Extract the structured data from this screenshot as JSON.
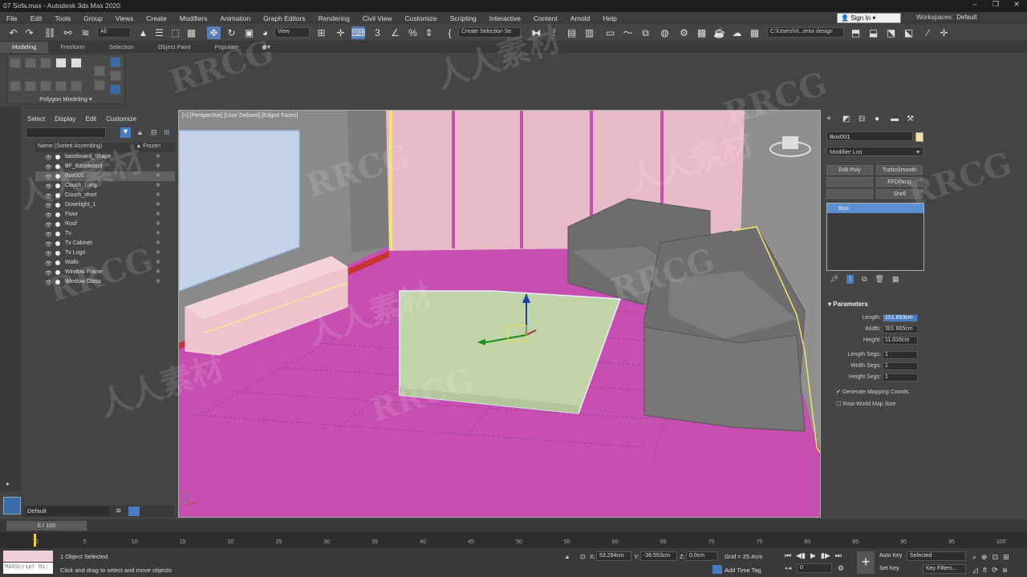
{
  "title": "07 Sofa.max - Autodesk 3ds Max 2020",
  "menu": [
    "File",
    "Edit",
    "Tools",
    "Group",
    "Views",
    "Create",
    "Modifiers",
    "Animation",
    "Graph Editors",
    "Rendering",
    "Civil View",
    "Customize",
    "Scripting",
    "Interactive",
    "Content",
    "Arnold",
    "Help"
  ],
  "signin": "Sign In",
  "workspace_label": "Workspaces:",
  "workspace_value": "Default",
  "toolbar": {
    "filter": "All",
    "refcoord": "View",
    "selset": "Create Selection Se",
    "path": "C:\\Users\\Vi...erior design"
  },
  "ribbon": {
    "tabs": [
      "Modeling",
      "Freeform",
      "Selection",
      "Object Paint",
      "Populate"
    ],
    "panel_label": "Polygon Modeling"
  },
  "scene": {
    "tabs": [
      "Select",
      "Display",
      "Edit",
      "Customize"
    ],
    "col_name": "Name (Sorted Ascending)",
    "col_frozen": "Frozen",
    "items": [
      "baseboard_Shape",
      "BF_Baseboard",
      "Box001",
      "Couch_Long",
      "Couch_short",
      "Downlight_1",
      "Floor",
      "Roof",
      "Tv",
      "Tv Cabinet",
      "Tv Logo",
      "Walls",
      "Window Frame",
      "Window Glass"
    ],
    "selected": "Box001",
    "layer": "Default"
  },
  "viewport": {
    "label": "[+] [Perspective] [User Defined] [Edged Faces]"
  },
  "command": {
    "object_name": "Box001",
    "modifier_list": "Modifier List",
    "buttons": [
      "Edit Poly",
      "TurboSmooth",
      "FFD(box)",
      "Shell"
    ],
    "stack_item": "Box",
    "params_title": "Parameters",
    "params": [
      {
        "label": "Length:",
        "value": "151.653cm"
      },
      {
        "label": "Width:",
        "value": "301.665cm"
      },
      {
        "label": "Height:",
        "value": "11.016cm"
      },
      {
        "label": "Length Segs:",
        "value": "1"
      },
      {
        "label": "Width Segs:",
        "value": "1"
      },
      {
        "label": "Height Segs:",
        "value": "1"
      }
    ],
    "gen_mapping": "Generate Mapping Coords.",
    "realworld": "Real-World Map Size"
  },
  "time": {
    "frame": "0 / 100",
    "ticks": [
      "0",
      "5",
      "10",
      "15",
      "20",
      "25",
      "30",
      "35",
      "40",
      "45",
      "50",
      "55",
      "60",
      "65",
      "70",
      "75",
      "80",
      "85",
      "90",
      "95",
      "100"
    ]
  },
  "status": {
    "maxscript": "MAXScript Mi:",
    "selected": "1 Object Selected",
    "hint": "Click and drag to select and move objects",
    "x_label": "X:",
    "x": "53.294cm",
    "y_label": "Y:",
    "y": "-36.553cm",
    "z_label": "Z:",
    "z": "0.0cm",
    "grid": "Grid = 25.4cm",
    "add_time_tag": "Add Time Tag",
    "auto_key": "Auto Key",
    "set_key": "Set Key",
    "key_mode": "Selected",
    "key_filters": "Key Filters...",
    "frame_field": "0"
  },
  "watermarks": [
    "RRCG",
    "人人素材",
    "RRCG",
    "人人素材",
    "RRCG",
    "人人素材",
    "RRCG",
    "RRCG",
    "人人素材",
    "RRCG",
    "人人素材",
    "RRCG"
  ],
  "colors": {
    "floor": "#c64fb1",
    "wall": "#e8b9c6",
    "accent": "#5a8fd0"
  }
}
